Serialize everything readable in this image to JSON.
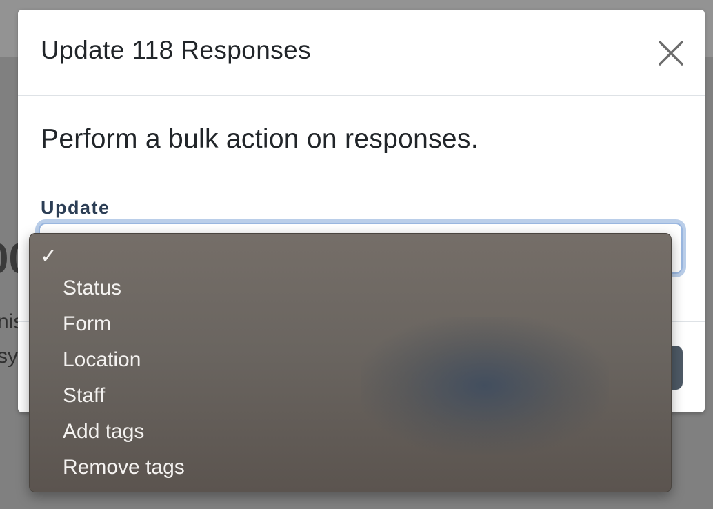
{
  "background": {
    "big_text_fragment": "00",
    "line1_fragment": "nis",
    "line2_fragment": "sy"
  },
  "modal": {
    "title": "Update 118 Responses",
    "description": "Perform a bulk action on responses.",
    "field_label": "Update",
    "select_value": ""
  },
  "dropdown": {
    "selected_index": 0,
    "options": [
      {
        "label": ""
      },
      {
        "label": "Status"
      },
      {
        "label": "Form"
      },
      {
        "label": "Location"
      },
      {
        "label": "Staff"
      },
      {
        "label": "Add tags"
      },
      {
        "label": "Remove tags"
      }
    ]
  }
}
